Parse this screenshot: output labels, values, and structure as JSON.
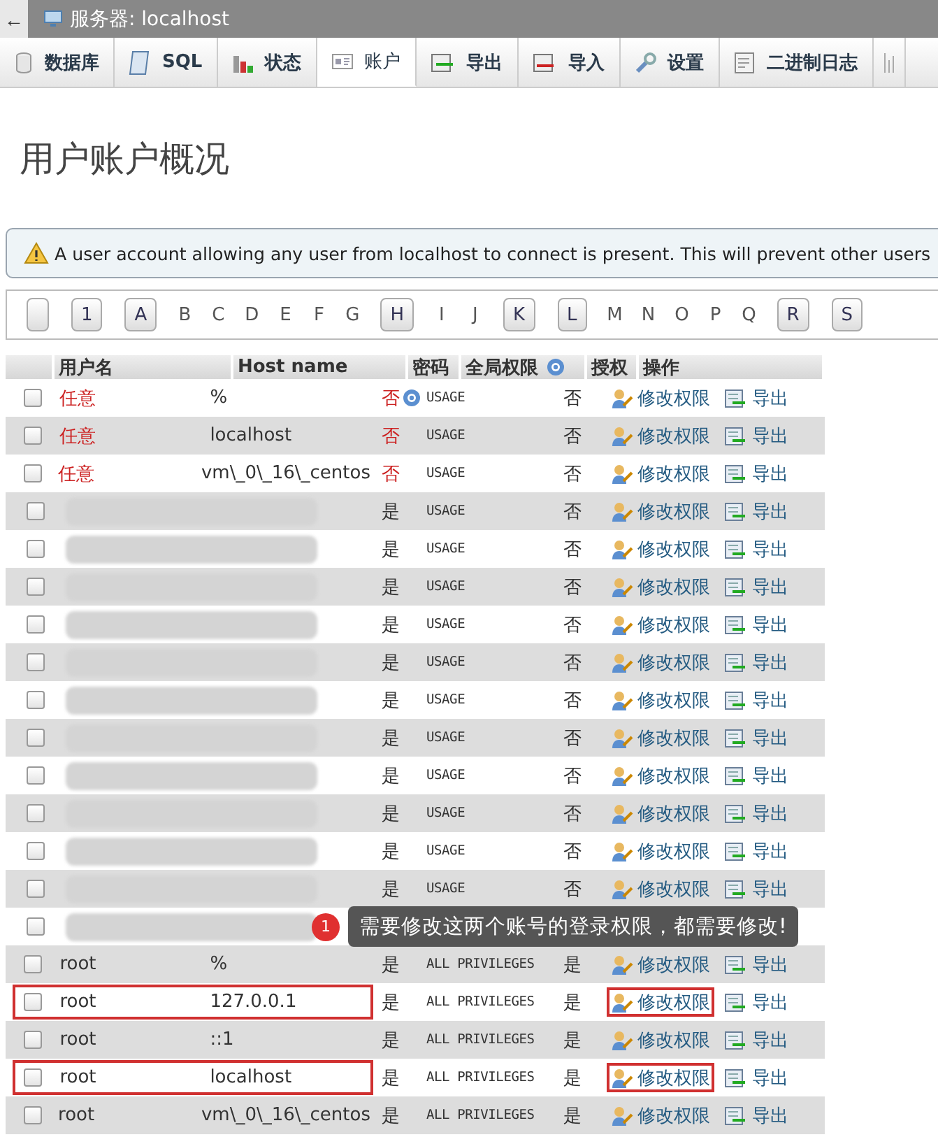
{
  "breadcrumb": {
    "back": "←",
    "server": "服务器: localhost"
  },
  "tabs": [
    {
      "label": "数据库",
      "selected": false
    },
    {
      "label": "SQL",
      "selected": false
    },
    {
      "label": "状态",
      "selected": false
    },
    {
      "label": "账户",
      "selected": true
    },
    {
      "label": "导出",
      "selected": false
    },
    {
      "label": "导入",
      "selected": false
    },
    {
      "label": "设置",
      "selected": false
    },
    {
      "label": "二进制日志",
      "selected": false
    }
  ],
  "page_title": "用户账户概况",
  "warning": "A user account allowing any user from localhost to connect is present. This will prevent other users",
  "letters": [
    {
      "has_users": true
    },
    {
      "label": "1",
      "has_users": true
    },
    {
      "label": "A",
      "has_users": true
    },
    {
      "label": "B",
      "has_users": false
    },
    {
      "label": "C",
      "has_users": false
    },
    {
      "label": "D",
      "has_users": false
    },
    {
      "label": "E",
      "has_users": false
    },
    {
      "label": "F",
      "has_users": false
    },
    {
      "label": "G",
      "has_users": false
    },
    {
      "label": "H",
      "has_users": true
    },
    {
      "label": "I",
      "has_users": false
    },
    {
      "label": "J",
      "has_users": false
    },
    {
      "label": "K",
      "has_users": true
    },
    {
      "label": "L",
      "has_users": true
    },
    {
      "label": "M",
      "has_users": false
    },
    {
      "label": "N",
      "has_users": false
    },
    {
      "label": "O",
      "has_users": false
    },
    {
      "label": "P",
      "has_users": false
    },
    {
      "label": "Q",
      "has_users": false
    },
    {
      "label": "R",
      "has_users": true
    },
    {
      "label": "S",
      "has_users": true
    }
  ],
  "table": {
    "columns": [
      "用户名",
      "Host name",
      "密码",
      "全局权限",
      "授权",
      "操作"
    ],
    "rows": [
      {
        "user": "任意",
        "host": "%",
        "password": "否",
        "password_help": true,
        "global": "USAGE",
        "grant": "否",
        "any_user": true,
        "redacted": false,
        "highlighted": false,
        "edit": "修改权限",
        "export": "导出"
      },
      {
        "user": "任意",
        "host": "localhost",
        "password": "否",
        "password_help": false,
        "global": "USAGE",
        "grant": "否",
        "any_user": true,
        "redacted": false,
        "highlighted": false,
        "edit": "修改权限",
        "export": "导出"
      },
      {
        "user": "任意",
        "host": "vm\\_0\\_16\\_centos",
        "password": "否",
        "password_help": false,
        "global": "USAGE",
        "grant": "否",
        "any_user": true,
        "redacted": false,
        "highlighted": false,
        "edit": "修改权限",
        "export": "导出"
      },
      {
        "password": "是",
        "password_help": false,
        "global": "USAGE",
        "grant": "否",
        "any_user": false,
        "redacted": true,
        "highlighted": false,
        "edit": "修改权限",
        "export": "导出"
      },
      {
        "password": "是",
        "password_help": false,
        "global": "USAGE",
        "grant": "否",
        "any_user": false,
        "redacted": true,
        "highlighted": false,
        "edit": "修改权限",
        "export": "导出"
      },
      {
        "password": "是",
        "password_help": false,
        "global": "USAGE",
        "grant": "否",
        "any_user": false,
        "redacted": true,
        "highlighted": false,
        "edit": "修改权限",
        "export": "导出"
      },
      {
        "password": "是",
        "password_help": false,
        "global": "USAGE",
        "grant": "否",
        "any_user": false,
        "redacted": true,
        "highlighted": false,
        "edit": "修改权限",
        "export": "导出"
      },
      {
        "password": "是",
        "password_help": false,
        "global": "USAGE",
        "grant": "否",
        "any_user": false,
        "redacted": true,
        "highlighted": false,
        "edit": "修改权限",
        "export": "导出"
      },
      {
        "password": "是",
        "password_help": false,
        "global": "USAGE",
        "grant": "否",
        "any_user": false,
        "redacted": true,
        "highlighted": false,
        "edit": "修改权限",
        "export": "导出"
      },
      {
        "password": "是",
        "password_help": false,
        "global": "USAGE",
        "grant": "否",
        "any_user": false,
        "redacted": true,
        "highlighted": false,
        "edit": "修改权限",
        "export": "导出"
      },
      {
        "password": "是",
        "password_help": false,
        "global": "USAGE",
        "grant": "否",
        "any_user": false,
        "redacted": true,
        "highlighted": false,
        "edit": "修改权限",
        "export": "导出"
      },
      {
        "password": "是",
        "password_help": false,
        "global": "USAGE",
        "grant": "否",
        "any_user": false,
        "redacted": true,
        "highlighted": false,
        "edit": "修改权限",
        "export": "导出"
      },
      {
        "password": "是",
        "password_help": false,
        "global": "USAGE",
        "grant": "否",
        "any_user": false,
        "redacted": true,
        "highlighted": false,
        "edit": "修改权限",
        "export": "导出"
      },
      {
        "password": "是",
        "password_help": false,
        "global": "USAGE",
        "grant": "否",
        "any_user": false,
        "redacted": true,
        "highlighted": false,
        "edit": "修改权限",
        "export": "导出"
      },
      {
        "password_help": false,
        "redacted": true,
        "highlighted": false
      },
      {
        "user": "root",
        "host": "%",
        "password": "是",
        "password_help": false,
        "global": "ALL PRIVILEGES",
        "grant": "是",
        "any_user": false,
        "redacted": false,
        "highlighted": false,
        "edit": "修改权限",
        "export": "导出"
      },
      {
        "user": "root",
        "host": "127.0.0.1",
        "password": "是",
        "password_help": false,
        "global": "ALL PRIVILEGES",
        "grant": "是",
        "any_user": false,
        "redacted": false,
        "highlighted": true,
        "edit": "修改权限",
        "export": "导出"
      },
      {
        "user": "root",
        "host": "::1",
        "password": "是",
        "password_help": false,
        "global": "ALL PRIVILEGES",
        "grant": "是",
        "any_user": false,
        "redacted": false,
        "highlighted": false,
        "edit": "修改权限",
        "export": "导出"
      },
      {
        "user": "root",
        "host": "localhost",
        "password": "是",
        "password_help": false,
        "global": "ALL PRIVILEGES",
        "grant": "是",
        "any_user": false,
        "redacted": false,
        "highlighted": true,
        "edit": "修改权限",
        "export": "导出"
      },
      {
        "user": "root",
        "host": "vm\\_0\\_16\\_centos",
        "password": "是",
        "password_help": false,
        "global": "ALL PRIVILEGES",
        "grant": "是",
        "any_user": false,
        "redacted": false,
        "highlighted": false,
        "edit": "修改权限",
        "export": "导出"
      }
    ]
  },
  "annotation": {
    "badge": "1",
    "text": "需要修改这两个账号的登录权限，都需要修改!"
  }
}
